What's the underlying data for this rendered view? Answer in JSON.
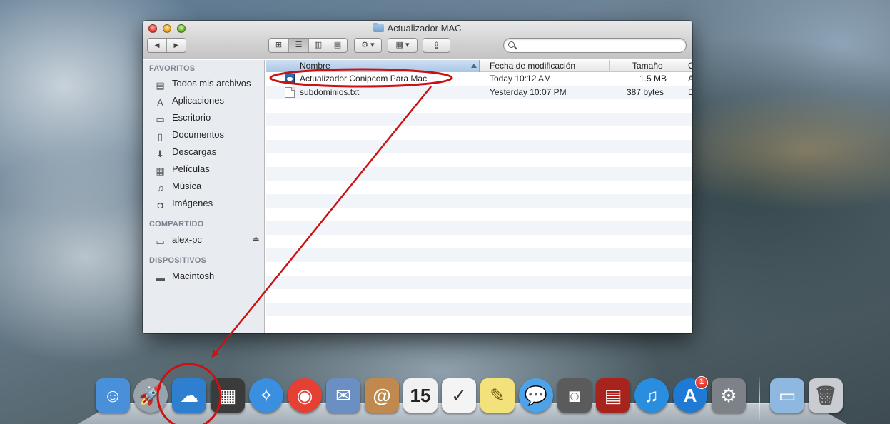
{
  "window": {
    "title": "Actualizador MAC"
  },
  "toolbar": {
    "back_glyph": "◀",
    "forward_glyph": "▶",
    "view_icon_glyph": "⊞",
    "view_list_glyph": "☰",
    "view_columns_glyph": "▥",
    "view_coverflow_glyph": "▤",
    "action_glyph": "⚙ ▾",
    "arrange_glyph": "▦ ▾",
    "share_glyph": "⇪",
    "search_placeholder": ""
  },
  "sidebar": {
    "favorites_header": "FAVORITOS",
    "favorites": [
      {
        "label": "Todos mis archivos",
        "icon": "all-files-icon",
        "glyph": "▤"
      },
      {
        "label": "Aplicaciones",
        "icon": "applications-icon",
        "glyph": "A"
      },
      {
        "label": "Escritorio",
        "icon": "desktop-icon",
        "glyph": "▭"
      },
      {
        "label": "Documentos",
        "icon": "documents-icon",
        "glyph": "▯"
      },
      {
        "label": "Descargas",
        "icon": "downloads-icon",
        "glyph": "⬇"
      },
      {
        "label": "Películas",
        "icon": "movies-icon",
        "glyph": "▦"
      },
      {
        "label": "Música",
        "icon": "music-icon",
        "glyph": "♫"
      },
      {
        "label": "Imágenes",
        "icon": "pictures-icon",
        "glyph": "◘"
      }
    ],
    "shared_header": "COMPARTIDO",
    "shared": [
      {
        "label": "alex-pc",
        "icon": "computer-icon",
        "glyph": "▭",
        "eject": "⏏"
      }
    ],
    "devices_header": "DISPOSITIVOS",
    "devices": [
      {
        "label": "Macintosh",
        "icon": "hard-drive-icon",
        "glyph": "▬"
      }
    ]
  },
  "columns": {
    "name": "Nombre",
    "modified": "Fecha de modificación",
    "size": "Tamaño",
    "kind": "C"
  },
  "files": [
    {
      "name": "Actualizador Conipcom  Para Mac",
      "modified": "Today 10:12 AM",
      "size": "1.5 MB",
      "kind": "A",
      "icon": "app-icon"
    },
    {
      "name": "subdominios.txt",
      "modified": "Yesterday 10:07 PM",
      "size": "387 bytes",
      "kind": "D",
      "icon": "text-file-icon"
    }
  ],
  "dock": {
    "items": [
      {
        "name": "finder-icon",
        "glyph": "☺",
        "bg": "#4a90d9"
      },
      {
        "name": "launchpad-icon",
        "glyph": "🚀",
        "bg": "#9aa3ab"
      },
      {
        "name": "cloud-app-icon",
        "glyph": "☁",
        "bg": "#2f7fd0"
      },
      {
        "name": "photo-booth-icon",
        "glyph": "▦",
        "bg": "#3b3b3b"
      },
      {
        "name": "safari-icon",
        "glyph": "✧",
        "bg": "#3a8fe0"
      },
      {
        "name": "chrome-icon",
        "glyph": "◉",
        "bg": "#e44134"
      },
      {
        "name": "mail-icon",
        "glyph": "✉",
        "bg": "#6b8fc2"
      },
      {
        "name": "address-book-icon",
        "glyph": "@",
        "bg": "#c08a4f"
      },
      {
        "name": "calendar-icon",
        "glyph": "15",
        "bg": "#f1f1f1"
      },
      {
        "name": "reminders-icon",
        "glyph": "✓",
        "bg": "#f4f4f4"
      },
      {
        "name": "notes-icon",
        "glyph": "✎",
        "bg": "#f3e17c"
      },
      {
        "name": "messages-icon",
        "glyph": "💬",
        "bg": "#4ca3ea"
      },
      {
        "name": "facetime-icon",
        "glyph": "◙",
        "bg": "#5b5b5b"
      },
      {
        "name": "photo-viewer-icon",
        "glyph": "▤",
        "bg": "#a8231b"
      },
      {
        "name": "itunes-icon",
        "glyph": "♫",
        "bg": "#2a8ee0"
      },
      {
        "name": "app-store-icon",
        "glyph": "A",
        "bg": "#1f7ad6"
      },
      {
        "name": "system-preferences-icon",
        "glyph": "⚙",
        "bg": "#7d8288"
      },
      {
        "name": "applications-folder-icon",
        "glyph": "▭",
        "bg": "#8fb8e0"
      },
      {
        "name": "trash-icon",
        "glyph": "🗑",
        "bg": "#c9cdd1"
      }
    ],
    "app_store_badge": "1"
  }
}
